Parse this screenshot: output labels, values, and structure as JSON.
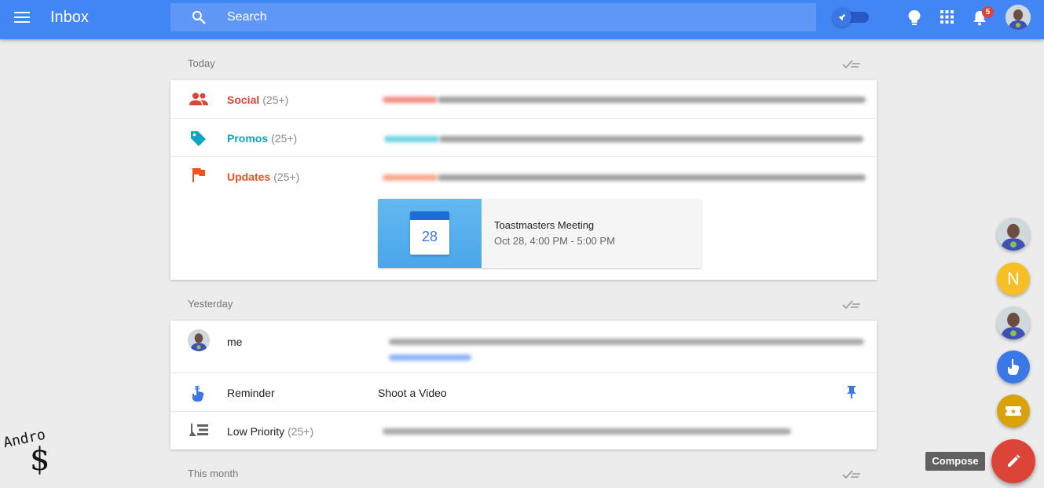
{
  "header": {
    "title": "Inbox",
    "search_placeholder": "Search",
    "notification_count": "5"
  },
  "sections": {
    "today": {
      "label": "Today",
      "bundles": [
        {
          "name": "Social",
          "count": "(25+)",
          "color": "#db4437",
          "icon": "people-icon"
        },
        {
          "name": "Promos",
          "count": "(25+)",
          "color": "#0fa5c2",
          "icon": "tag-icon"
        },
        {
          "name": "Updates",
          "count": "(25+)",
          "color": "#f4511e",
          "icon": "flag-icon"
        }
      ],
      "event": {
        "day": "28",
        "title": "Toastmasters Meeting",
        "time": "Oct 28, 4:00 PM - 5:00 PM"
      }
    },
    "yesterday": {
      "label": "Yesterday",
      "rows": [
        {
          "name": "me"
        },
        {
          "name": "Reminder",
          "subject": "Shoot a Video"
        },
        {
          "name": "Low Priority",
          "count": "(25+)"
        }
      ]
    },
    "this_month": {
      "label": "This month"
    }
  },
  "rail": {
    "contacts": [
      {
        "initial": "N",
        "color": "#f6bf26"
      }
    ],
    "reminder_color": "#3b78e7",
    "trips_color": "#d9a10c"
  },
  "compose": {
    "label": "Compose",
    "color": "#db4437"
  },
  "watermark": {
    "line1": "Andro",
    "line2": "$"
  },
  "colors": {
    "brand": "#4285f4",
    "background": "#ececec"
  }
}
